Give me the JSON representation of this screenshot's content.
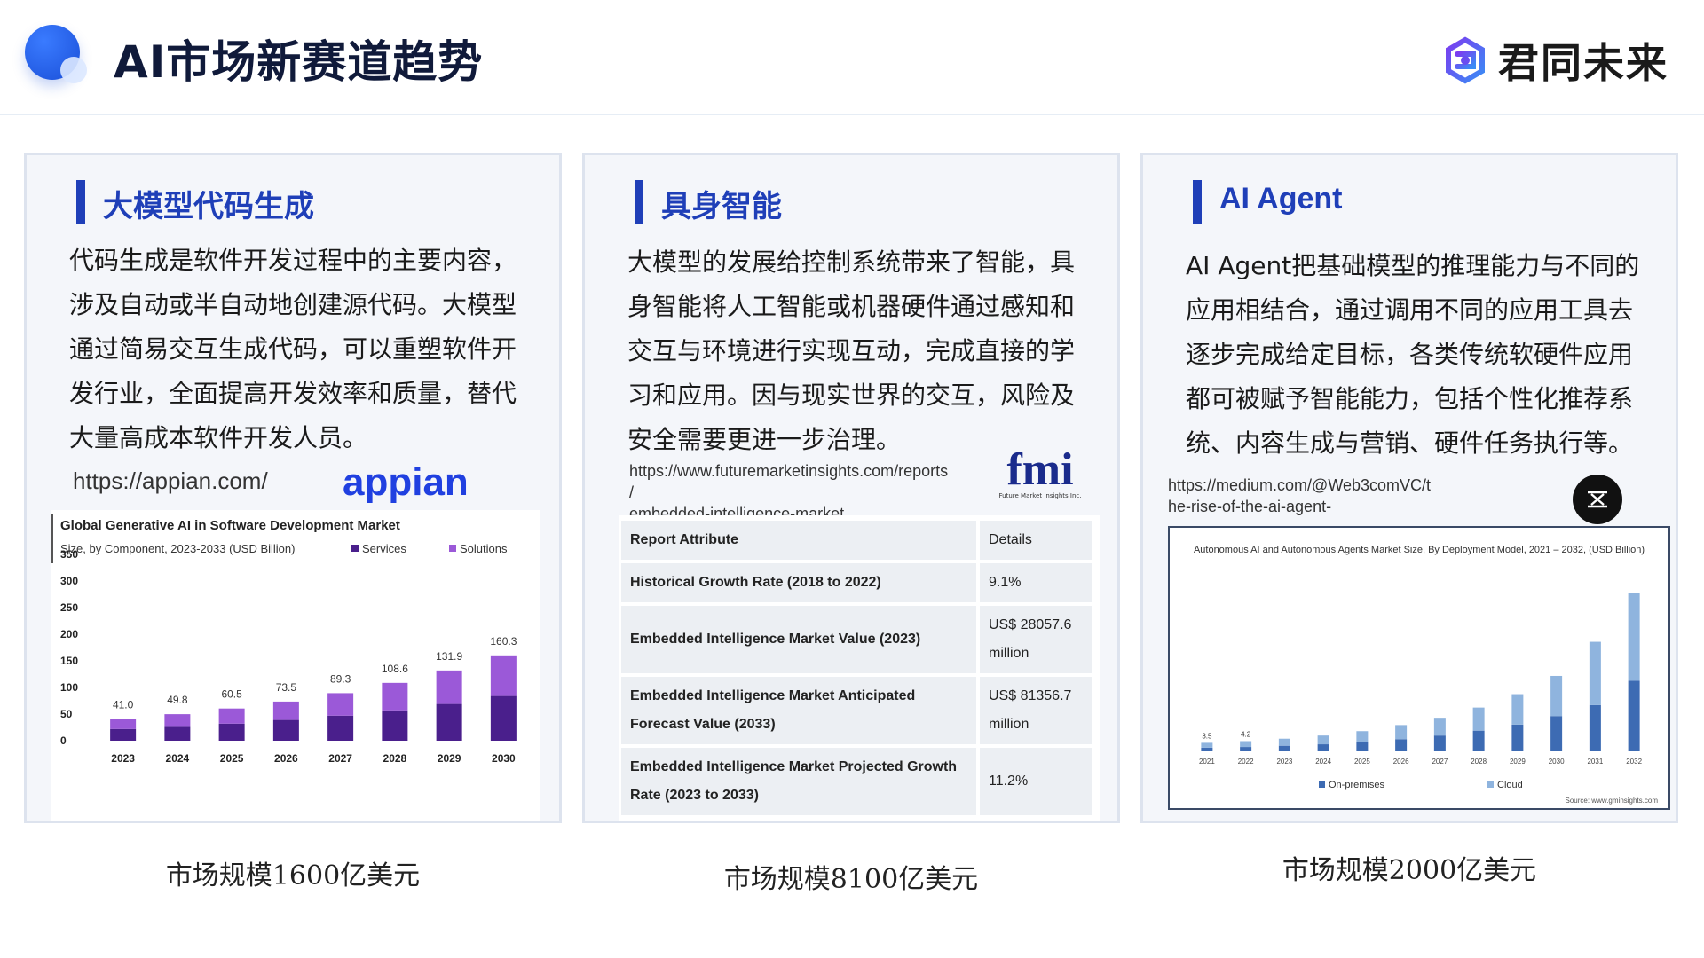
{
  "header": {
    "title": "AI市场新赛道趋势",
    "brand": "君同未来"
  },
  "panels": [
    {
      "title": "大模型代码生成",
      "body": "代码生成是软件开发过程中的主要内容，涉及自动或半自动地创建源代码。大模型通过简易交互生成代码，可以重塑软件开发行业，全面提高开发效率和质量，替代大量高成本软件开发人员。",
      "link": "https://appian.com/",
      "logo": "appian",
      "caption": "市场规模1600亿美元"
    },
    {
      "title": "具身智能",
      "body": "大模型的发展给控制系统带来了智能，具身智能将人工智能或机器硬件通过感知和交互与环境进行实现互动，完成直接的学习和应用。因与现实世界的交互，风险及安全需要更进一步治理。",
      "link_line1": "https://www.futuremarketinsights.com/reports",
      "link_line2": "/",
      "link_line3": "embedded-intelligence-market",
      "logo": "fmi",
      "logo_sub": "Future Market Insights Inc.",
      "caption": "市场规模8100亿美元"
    },
    {
      "title": "AI Agent",
      "body": "AI Agent把基础模型的推理能力与不同的应用相结合，通过调用不同的应用工具去逐步完成给定目标，各类传统软硬件应用都可被赋予智能能力，包括个性化推荐系统、内容生成与营销、硬件任务执行等。",
      "link_line1": "https://medium.com/@Web3comVC/t",
      "link_line2": "he-rise-of-the-ai-agent-",
      "caption": "市场规模2000亿美元"
    }
  ],
  "table": {
    "rows": [
      {
        "k": "Report Attribute",
        "v": "Details"
      },
      {
        "k": "Historical Growth Rate (2018 to 2022)",
        "v": "9.1%"
      },
      {
        "k": "Embedded Intelligence Market Value (2023)",
        "v": "US$ 28057.6 million"
      },
      {
        "k": "Embedded Intelligence Market Anticipated Forecast Value (2033)",
        "v": "US$ 81356.7 million"
      },
      {
        "k": "Embedded Intelligence Market Projected Growth Rate (2023 to 2033)",
        "v": "11.2%"
      }
    ]
  },
  "chart_data": [
    {
      "type": "bar",
      "title": "Global Generative AI in Software Development Market",
      "subtitle": "Size, by Component, 2023-2033 (USD Billion)",
      "categories": [
        "2023",
        "2024",
        "2025",
        "2026",
        "2027",
        "2028",
        "2029",
        "2030"
      ],
      "totals": [
        41.0,
        49.8,
        60.5,
        73.5,
        89.3,
        108.6,
        131.9,
        160.3
      ],
      "series": [
        {
          "name": "Services",
          "values": [
            22,
            26,
            32,
            39,
            47,
            57,
            69,
            84
          ],
          "color": "#4a1f8c"
        },
        {
          "name": "Solutions",
          "values": [
            19,
            23.8,
            28.5,
            34.5,
            42.3,
            51.6,
            62.9,
            76.3
          ],
          "color": "#9b59d8"
        }
      ],
      "y_ticks": [
        "0",
        "50",
        "100",
        "150",
        "200",
        "250",
        "300",
        "350"
      ],
      "ylim": [
        0,
        350
      ]
    },
    {
      "type": "bar",
      "title": "Autonomous AI and Autonomous Agents Market Size, By Deployment Model, 2021 – 2032, (USD Billion)",
      "categories": [
        "2021",
        "2022",
        "2023",
        "2024",
        "2025",
        "2026",
        "2027",
        "2028",
        "2029",
        "2030",
        "2031",
        "2032"
      ],
      "labels": [
        "3.5",
        "4.2",
        "",
        "",
        "",
        "",
        "",
        "",
        "",
        "",
        "",
        ""
      ],
      "series": [
        {
          "name": "On-premises",
          "values": [
            1.5,
            1.8,
            2.3,
            2.9,
            3.8,
            5.0,
            6.5,
            8.5,
            11.0,
            14.5,
            19.0,
            29.0
          ],
          "color": "#3d6bb3"
        },
        {
          "name": "Cloud",
          "values": [
            2.0,
            2.4,
            2.9,
            3.6,
            4.5,
            5.8,
            7.3,
            9.5,
            12.5,
            16.5,
            26.0,
            36.0
          ],
          "color": "#8fb4de"
        }
      ],
      "ylim": [
        0,
        70
      ],
      "source": "Source: www.gminsights.com"
    }
  ]
}
